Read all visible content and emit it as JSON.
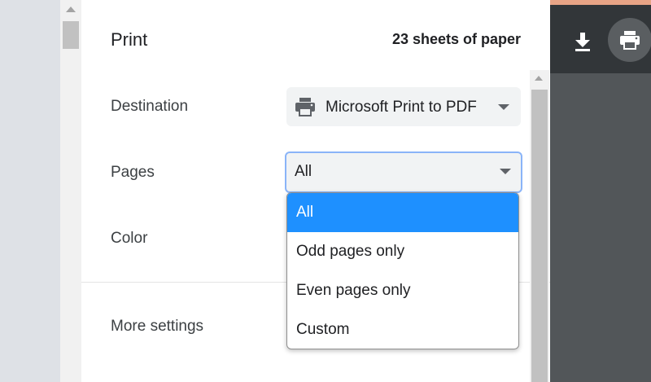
{
  "dialog": {
    "title": "Print",
    "sheets": "23 sheets of paper"
  },
  "destination": {
    "label": "Destination",
    "value": "Microsoft Print to PDF",
    "icon": "printer-icon"
  },
  "pages": {
    "label": "Pages",
    "value": "All",
    "options": [
      "All",
      "Odd pages only",
      "Even pages only",
      "Custom"
    ],
    "selected_index": 0
  },
  "color": {
    "label": "Color"
  },
  "more_settings": {
    "label": "More settings"
  },
  "toolbar": {
    "download_icon": "download-icon",
    "print_icon": "printer-icon"
  },
  "colors": {
    "selected_option": "#1e90ff",
    "focus_border": "#8ab4f8",
    "preview_bg": "#525659",
    "preview_toolbar": "#323639"
  }
}
